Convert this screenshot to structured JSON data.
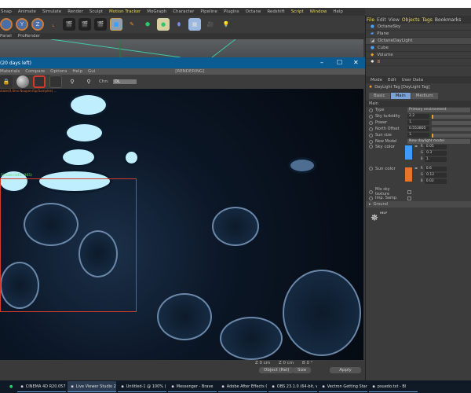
{
  "menubar": [
    "Snap",
    "Animate",
    "Simulate",
    "Render",
    "Sculpt",
    "Motion Tracker",
    "MoGraph",
    "Character",
    "Pipeline",
    "Plugins",
    "Octane",
    "Redshift",
    "Script",
    "Window",
    "Help"
  ],
  "menubar_highlight": [
    "Motion Tracker",
    "Script",
    "Window"
  ],
  "subbar": [
    "Panel",
    "ProRender"
  ],
  "live_viewer": {
    "title": "(20 days left)",
    "menu": [
      "Materials",
      "Compare",
      "Options",
      "Help",
      "Gui"
    ],
    "status": "[RENDERING]",
    "channel_label": "Chn:",
    "channel_value": "DL",
    "selection_label": "5) size:(445, 365)",
    "stats_line": "state(0.0ms  Noupen/Sp/Samples)  ...",
    "minimize": "–",
    "maximize": "☐",
    "close": "✕"
  },
  "bottom": {
    "z1": "Z  0 cm",
    "z2": "Z  0 cm",
    "b": "B  0 °",
    "coord_mode": "Object (Rel)",
    "size_mode": "Size",
    "apply": "Apply"
  },
  "objects": {
    "menu": [
      "File",
      "Edit",
      "View",
      "Objects",
      "Tags",
      "Bookmarks"
    ],
    "items": [
      "OctaneSky",
      "Plane",
      "OctaneDayLight",
      "Cube",
      "Volume",
      "8"
    ]
  },
  "attributes": {
    "menu": [
      "Mode",
      "Edit",
      "User Data"
    ],
    "tag_title": "DayLight Tag [DayLight Tag]",
    "tabs": [
      "Basic",
      "Main",
      "Medium"
    ],
    "active_tab": "Main",
    "section": "Main",
    "type_label": "Type",
    "type_value": "Primary environment",
    "sky_turbidity_label": "Sky turbidity",
    "sky_turbidity": "2.2",
    "power_label": "Power",
    "power": "1.",
    "north_offset_label": "North Offset",
    "north_offset": "0.553805",
    "sun_size_label": "Sun size",
    "sun_size": "1.",
    "new_model_label": "New Model",
    "new_model_value": "New daylight model",
    "sky_color_label": "Sky color",
    "sky_color": {
      "hex": "#3d9bff",
      "R": "0.05",
      "G": "0.3",
      "B": "1."
    },
    "sun_color_label": "Sun color",
    "sun_color": {
      "hex": "#e8742a",
      "R": "0.6",
      "G": "0.12",
      "B": "0.02"
    },
    "mix_sky_label": "Mix sky texture",
    "imp_samp_label": "Imp. Samp.",
    "ground_label": "Ground",
    "help_label": "HELP"
  },
  "taskbar": [
    {
      "label": "CINEMA 4D R20.057 S...",
      "active": false
    },
    {
      "label": "Live Viewer Studio 20...",
      "active": true
    },
    {
      "label": "Untitled-1 @ 100% (L...",
      "active": false
    },
    {
      "label": "Messenger - Brave",
      "active": false
    },
    {
      "label": "Adobe After Effects C...",
      "active": false
    },
    {
      "label": "OBS 23.1.0 (64-bit, wi...",
      "active": false
    },
    {
      "label": "Vectron Getting Started",
      "active": false
    },
    {
      "label": "psuedo.txt - Bl",
      "active": false
    }
  ]
}
